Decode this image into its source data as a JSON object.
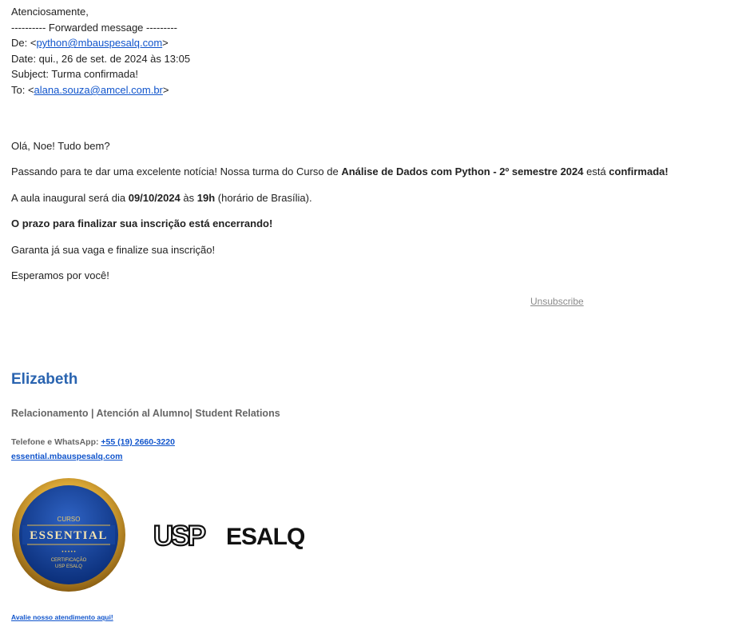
{
  "forward": {
    "sign_off": "Atenciosamente,",
    "separator": "---------- Forwarded message ---------",
    "from_label": "De: <",
    "from_email": "python@mbauspesalq.com",
    "from_close": ">",
    "date": "Date: qui., 26 de set. de 2024 às 13:05",
    "subject": "Subject: Turma confirmada!",
    "to_label": "To: <",
    "to_email": "alana.souza@amcel.com.br",
    "to_close": ">"
  },
  "body": {
    "greeting": "Olá, Noe! Tudo bem?",
    "p1_a": "Passando para te dar uma excelente notícia! Nossa turma do Curso de ",
    "p1_b": "Análise de Dados com Python - 2º semestre 2024",
    "p1_c": " está ",
    "p1_d": "confirmada!",
    "p2_a": "A aula inaugural será dia ",
    "p2_b": "09/10/2024",
    "p2_c": " às ",
    "p2_d": "19h",
    "p2_e": " (horário de Brasília).",
    "p3": "O prazo para finalizar sua inscrição está encerrando!",
    "p4": "Garanta já sua vaga e finalize sua inscrição!",
    "p5": "Esperamos por você!",
    "unsubscribe": "Unsubscribe"
  },
  "signature": {
    "name": "Elizabeth",
    "role": "Relacionamento | Atención al Alumno| Student Relations",
    "phone_label": "Telefone e WhatsApp: ",
    "phone": "+55 (19) 2660-3220",
    "site": "essential.mbauspesalq.com",
    "feedback": "Avalie nosso atendimento aqui!",
    "badge": {
      "top": "CURSO",
      "title": "ESSENTIAL",
      "line1": "CERTIFICAÇÃO",
      "line2": "USP ESALQ",
      "dots": "• • • • •"
    },
    "logo_usp": "USP",
    "logo_esalq": "ESALQ"
  }
}
